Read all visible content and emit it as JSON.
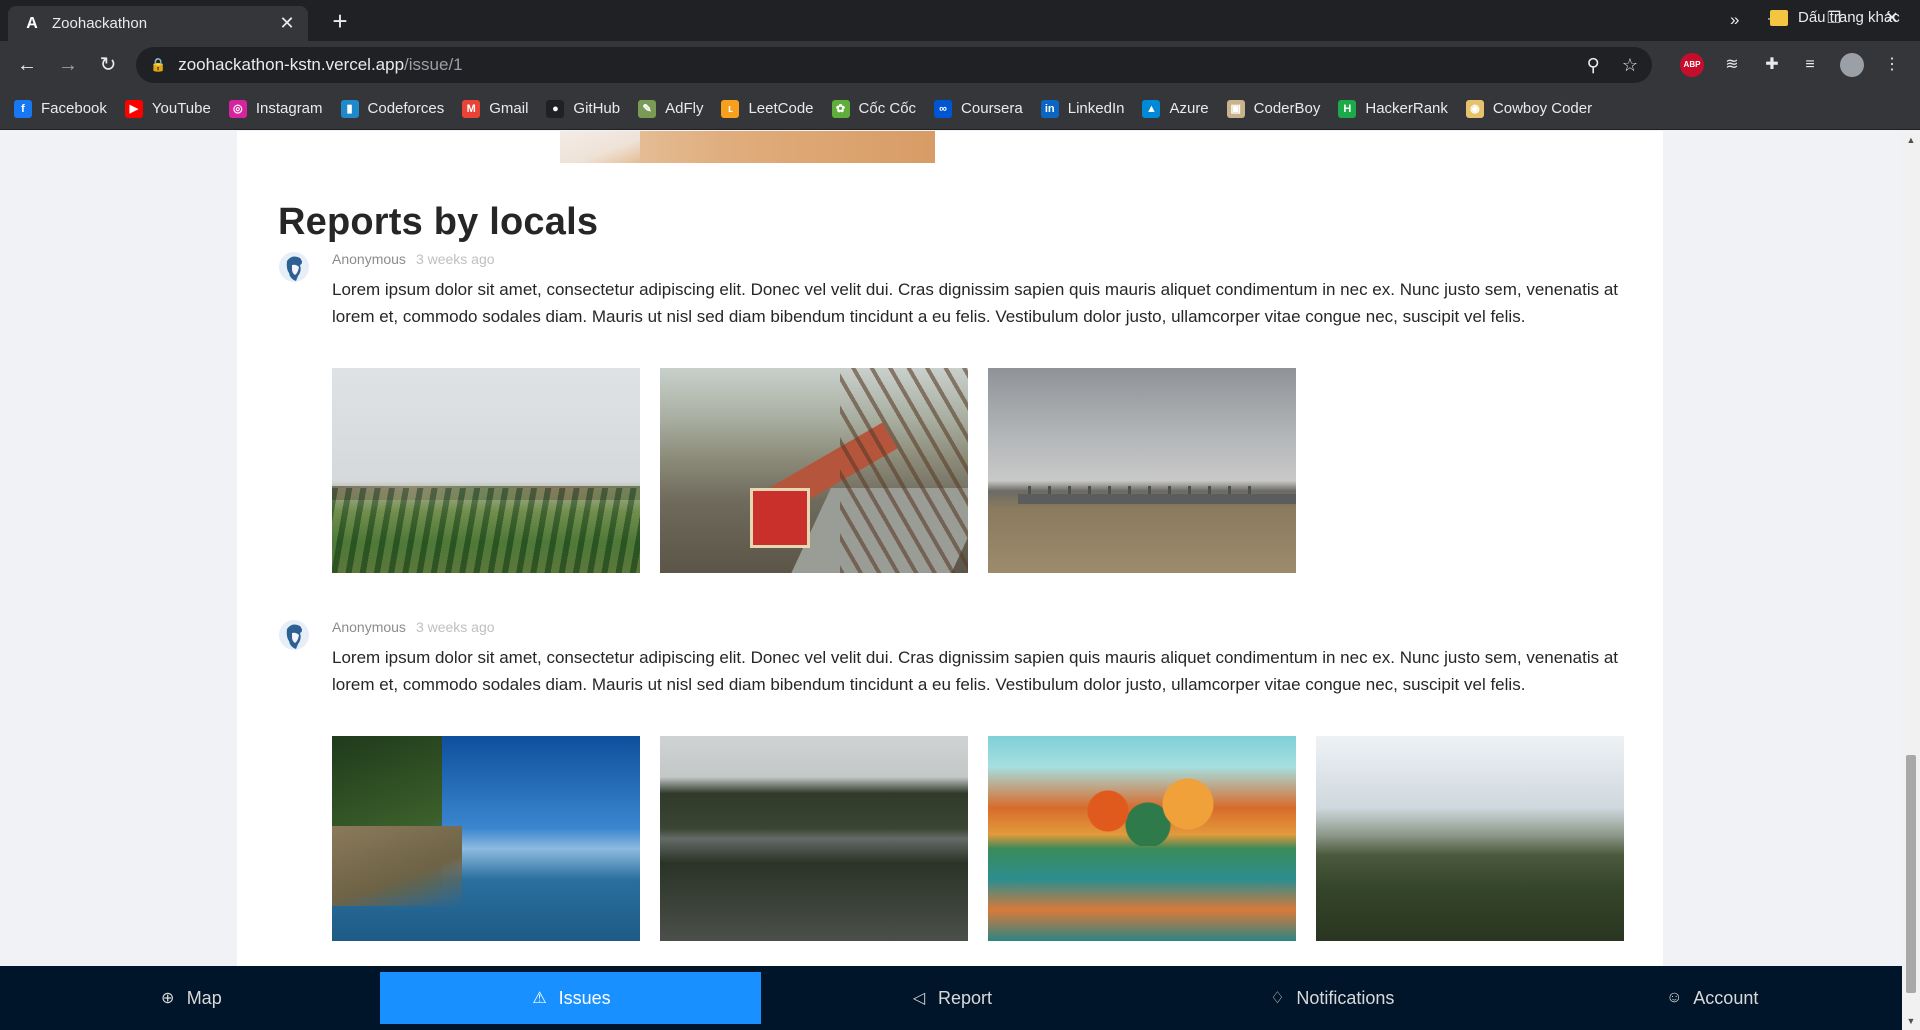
{
  "browser": {
    "tab_title": "Zoohackathon",
    "tab_favicon": "A",
    "url_host": "zoohackathon-kstn.vercel.app",
    "url_path": "/issue/1",
    "bookmarks": [
      {
        "label": "Facebook",
        "icon": "facebook-icon",
        "color": "#1877f2",
        "glyph": "f"
      },
      {
        "label": "YouTube",
        "icon": "youtube-icon",
        "color": "#ff0000",
        "glyph": "▶"
      },
      {
        "label": "Instagram",
        "icon": "instagram-icon",
        "color": "#d6249f",
        "glyph": "◎"
      },
      {
        "label": "Codeforces",
        "icon": "codeforces-icon",
        "color": "#1f8acb",
        "glyph": "▮"
      },
      {
        "label": "Gmail",
        "icon": "gmail-icon",
        "color": "#ea4335",
        "glyph": "M"
      },
      {
        "label": "GitHub",
        "icon": "github-icon",
        "color": "#202124",
        "glyph": "●"
      },
      {
        "label": "AdFly",
        "icon": "adfly-icon",
        "color": "#7a9a55",
        "glyph": "✎"
      },
      {
        "label": "LeetCode",
        "icon": "leetcode-icon",
        "color": "#f89f1b",
        "glyph": "ʟ"
      },
      {
        "label": "Cốc Cốc",
        "icon": "coccoc-icon",
        "color": "#5fae3c",
        "glyph": "✿"
      },
      {
        "label": "Coursera",
        "icon": "coursera-icon",
        "color": "#0056d2",
        "glyph": "∞"
      },
      {
        "label": "LinkedIn",
        "icon": "linkedin-icon",
        "color": "#0a66c2",
        "glyph": "in"
      },
      {
        "label": "Azure",
        "icon": "azure-icon",
        "color": "#0089d6",
        "glyph": "▲"
      },
      {
        "label": "CoderBoy",
        "icon": "coderboy-icon",
        "color": "#c9b38a",
        "glyph": "▣"
      },
      {
        "label": "HackerRank",
        "icon": "hackerrank-icon",
        "color": "#1ba94c",
        "glyph": "H"
      },
      {
        "label": "Cowboy Coder",
        "icon": "cowboy-coder-icon",
        "color": "#e5c26b",
        "glyph": "◉"
      }
    ],
    "bookmarks_more": "»",
    "other_bookmarks": "Dấu trang khác"
  },
  "page": {
    "section_title": "Reports by locals",
    "comments": [
      {
        "author": "Anonymous",
        "time": "3 weeks ago",
        "text": "Lorem ipsum dolor sit amet, consectetur adipiscing elit. Donec vel velit dui. Cras dignissim sapien quis mauris aliquet condimentum in nec ex. Nunc justo sem, venenatis at lorem et, commodo sodales diam. Mauris ut nisl sed diam bibendum tincidunt a eu felis. Vestibulum dolor justo, ullamcorper vitae congue nec, suscipit vel felis.",
        "photos": [
          "fields-photo",
          "bridge-train-photo",
          "industrial-plant-photo"
        ]
      },
      {
        "author": "Anonymous",
        "time": "3 weeks ago",
        "text": "Lorem ipsum dolor sit amet, consectetur adipiscing elit. Donec vel velit dui. Cras dignissim sapien quis mauris aliquet condimentum in nec ex. Nunc justo sem, venenatis at lorem et, commodo sodales diam. Mauris ut nisl sed diam bibendum tincidunt a eu felis. Vestibulum dolor justo, ullamcorper vitae congue nec, suscipit vel felis.",
        "photos": [
          "blue-lake-photo",
          "dark-lake-photo",
          "autumn-lake-photo",
          "hills-photo"
        ]
      }
    ]
  },
  "bottom_nav": {
    "items": [
      {
        "label": "Map",
        "icon": "globe-icon",
        "active": false
      },
      {
        "label": "Issues",
        "icon": "warning-icon",
        "active": true
      },
      {
        "label": "Report",
        "icon": "megaphone-icon",
        "active": false
      },
      {
        "label": "Notifications",
        "icon": "bell-icon",
        "active": false
      },
      {
        "label": "Account",
        "icon": "user-icon",
        "active": false
      }
    ]
  },
  "colors": {
    "nav_background": "#001529",
    "nav_active": "#1890ff",
    "page_background": "#f0f2f5"
  }
}
